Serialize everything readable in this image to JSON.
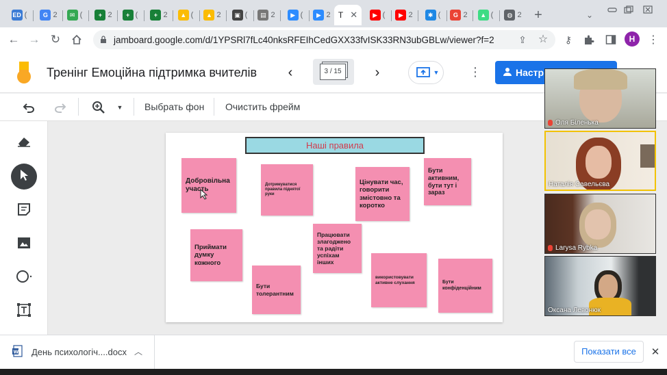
{
  "browser": {
    "tabs": [
      {
        "icon": "edera-icon",
        "text": "ED",
        "color": "#3a7bd5"
      },
      {
        "icon": "translate-icon",
        "text": "G",
        "color": "#4285f4"
      },
      {
        "icon": "mail-icon",
        "text": "✉",
        "color": "#34a853"
      },
      {
        "icon": "sheets-icon",
        "text": "+",
        "color": "#188038"
      },
      {
        "icon": "sheets-icon",
        "text": "+",
        "color": "#188038"
      },
      {
        "icon": "sheets-icon",
        "text": "+",
        "color": "#188038"
      },
      {
        "icon": "drive-icon",
        "text": "▲",
        "color": "#fbbc04"
      },
      {
        "icon": "drive-icon",
        "text": "▲",
        "color": "#fbbc04"
      },
      {
        "icon": "classroom-icon",
        "text": "▣",
        "color": "#444"
      },
      {
        "icon": "document-icon",
        "text": "▤",
        "color": "#777"
      },
      {
        "icon": "zoom-icon",
        "text": "▶",
        "color": "#2d8cff"
      },
      {
        "icon": "zoom-icon",
        "text": "▶",
        "color": "#2d8cff"
      },
      {
        "icon": "youtube-icon",
        "text": "▶",
        "color": "#ff0000"
      },
      {
        "icon": "youtube-icon",
        "text": "▶",
        "color": "#ff0000"
      },
      {
        "icon": "snowflake-icon",
        "text": "✱",
        "color": "#1e88e5"
      },
      {
        "icon": "google-icon",
        "text": "G",
        "color": "#ea4335"
      },
      {
        "icon": "android-icon",
        "text": "▲",
        "color": "#3ddc84"
      },
      {
        "icon": "globe-icon",
        "text": "◍",
        "color": "#5f6368"
      }
    ],
    "tab_text": "(",
    "tab_text_alt": "2",
    "active_tab_label": "T",
    "url": "jamboard.google.com/d/1YPSRl7fLc40nksRFEIhCedGXX33fvISK33RN3ubGBLw/viewer?f=2",
    "profile_letter": "H",
    "profile_color": "#8e24aa"
  },
  "jamboard": {
    "title": "Тренінг Емоційна підтримка вчителів",
    "frame_counter": "3 / 15",
    "share_label": "Настр",
    "edit_bar": {
      "set_background": "Выбрать фон",
      "clear_frame": "Очистить фрейм"
    },
    "banner": "Наші правила",
    "notes": [
      {
        "text": "Добровільна участь"
      },
      {
        "text": "Дотримуватися правила піднятої руки"
      },
      {
        "text": "Цінувати час, говорити змістовно та коротко"
      },
      {
        "text": "Бути активним, бути тут і зараз"
      },
      {
        "text": "Приймати думку кожного"
      },
      {
        "text": "Працювати злагоджено та радіти успіхам інших"
      },
      {
        "text": "Бути толерантним"
      },
      {
        "text": "використовувати активне слухання"
      },
      {
        "text": "Бути конфіденційним"
      }
    ],
    "note_color": "#f48fb1",
    "banner_color": "#9ad9e3"
  },
  "video_participants": [
    {
      "name": "Оля Біленька",
      "muted": true
    },
    {
      "name": "Наталія Савельєва",
      "muted": false
    },
    {
      "name": "Larysa Rybka",
      "muted": true
    },
    {
      "name": "Оксана Левонюк",
      "muted": false
    }
  ],
  "downloads": {
    "file_name": "День психологіч....docx",
    "show_all": "Показати все"
  }
}
